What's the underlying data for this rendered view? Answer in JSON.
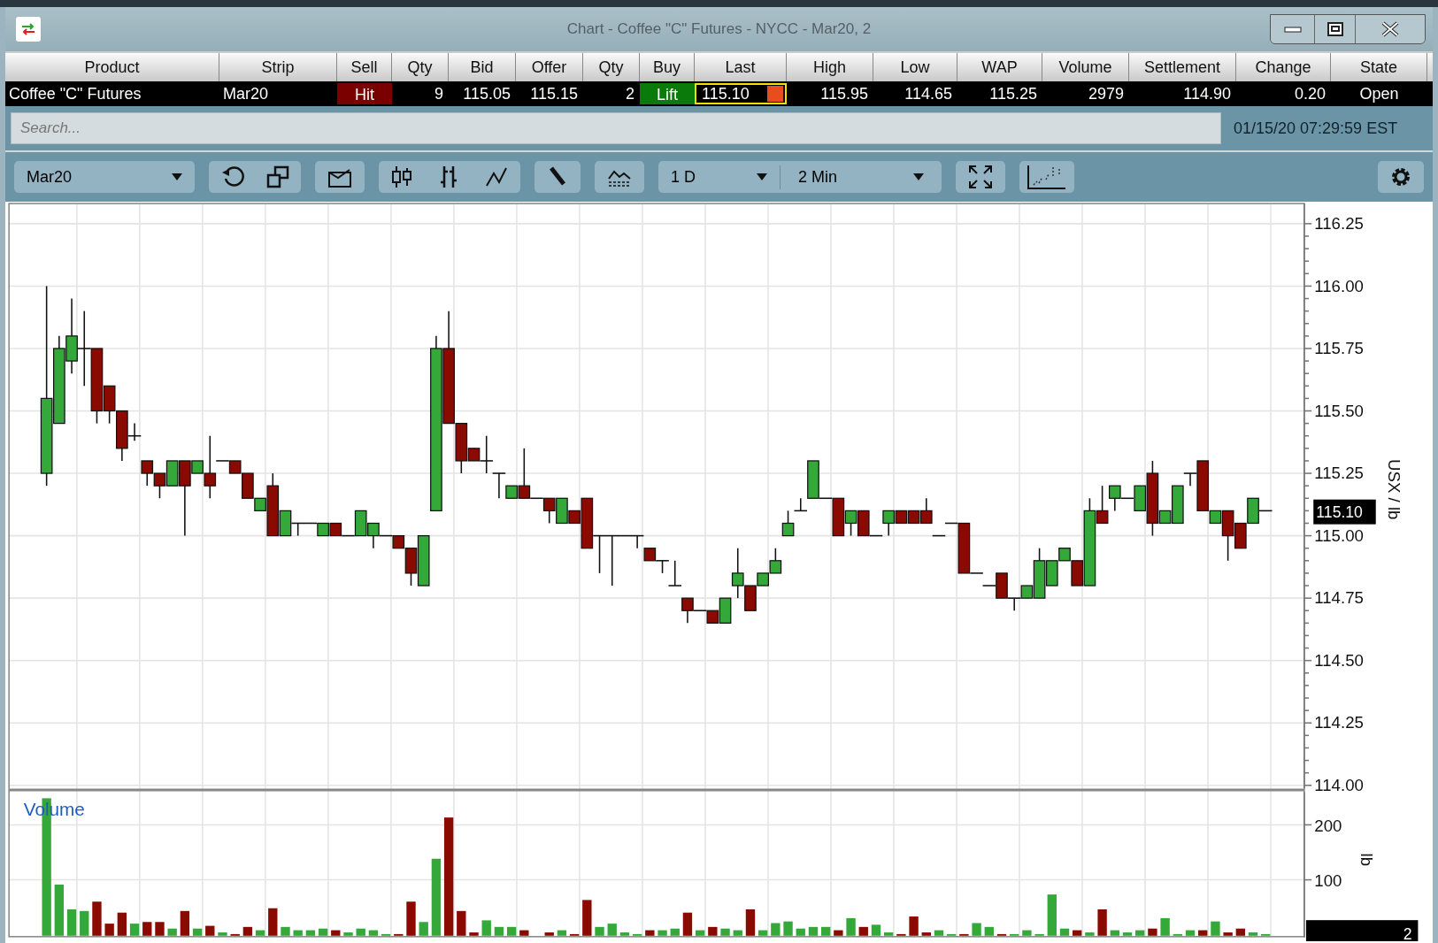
{
  "window": {
    "title": "Chart - Coffee \"C\" Futures - NYCC - Mar20, 2"
  },
  "quote_table": {
    "columns": [
      "Product",
      "Strip",
      "Sell",
      "Qty",
      "Bid",
      "Offer",
      "Qty",
      "Buy",
      "Last",
      "High",
      "Low",
      "WAP",
      "Volume",
      "Settlement",
      "Change",
      "State"
    ],
    "row": [
      {
        "kind": "name",
        "text": "Coffee \"C\" Futures"
      },
      {
        "kind": "name",
        "text": "Mar20"
      },
      {
        "kind": "sell",
        "text": "Hit"
      },
      {
        "kind": "number",
        "text": "9"
      },
      {
        "kind": "number",
        "text": "115.05"
      },
      {
        "kind": "number",
        "text": "115.15"
      },
      {
        "kind": "number",
        "text": "2"
      },
      {
        "kind": "buy",
        "text": "Lift"
      },
      {
        "kind": "last",
        "text": "115.10"
      },
      {
        "kind": "number",
        "text": "115.95"
      },
      {
        "kind": "number",
        "text": "114.65"
      },
      {
        "kind": "number",
        "text": "115.25"
      },
      {
        "kind": "number",
        "text": "2979"
      },
      {
        "kind": "number",
        "text": "114.90"
      },
      {
        "kind": "number",
        "text": "0.20"
      },
      {
        "kind": "status",
        "text": "Open"
      }
    ]
  },
  "search": {
    "placeholder": "Search..."
  },
  "timestamp": "01/15/20 07:29:59 EST",
  "toolbar": {
    "contract": "Mar20",
    "range": "1 D",
    "interval": "2 Min"
  },
  "price_axis": {
    "ticks": [
      "116.25",
      "116.00",
      "115.75",
      "115.50",
      "115.25",
      "115.00",
      "114.75",
      "114.50",
      "114.25",
      "114.00"
    ],
    "unit": "USX / lb",
    "last": "115.10"
  },
  "volume_panel": {
    "title": "Volume",
    "ticks": [
      "200",
      "100"
    ],
    "unit": "lb",
    "last": "2"
  }
}
